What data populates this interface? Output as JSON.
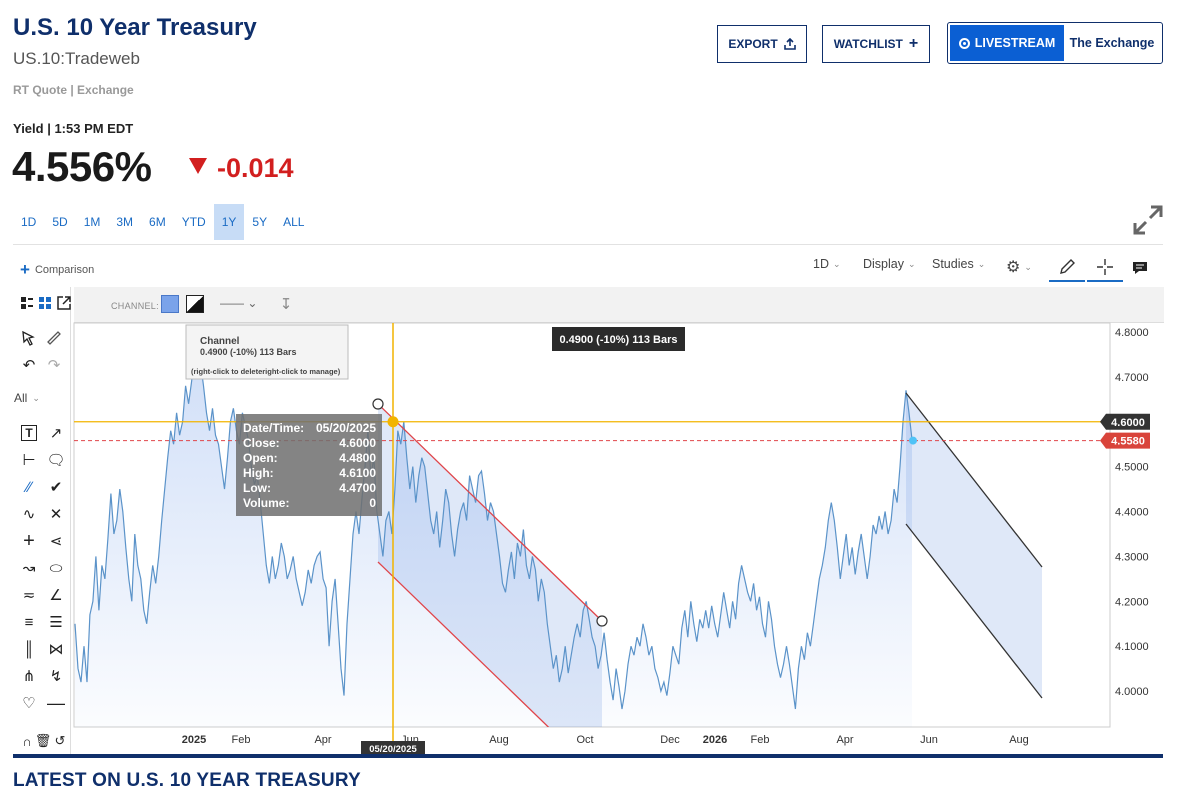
{
  "header": {
    "title": "U.S. 10 Year Treasury",
    "symbol": "US.10:Tradeweb",
    "quote_source": "RT Quote | Exchange",
    "export_label": "EXPORT",
    "watchlist_label": "WATCHLIST",
    "livestream_label": "LIVESTREAM",
    "exchange_label": "The Exchange"
  },
  "quote": {
    "label": "Yield | 1:53 PM EDT",
    "value": "4.556%",
    "change": "-0.014",
    "direction": "down",
    "change_color": "#d21f1f"
  },
  "ranges": [
    {
      "label": "1D",
      "active": false
    },
    {
      "label": "5D",
      "active": false
    },
    {
      "label": "1M",
      "active": false
    },
    {
      "label": "3M",
      "active": false
    },
    {
      "label": "6M",
      "active": false
    },
    {
      "label": "YTD",
      "active": false
    },
    {
      "label": "1Y",
      "active": true
    },
    {
      "label": "5Y",
      "active": false
    },
    {
      "label": "ALL",
      "active": false
    }
  ],
  "toolbar": {
    "comparison_label": "Comparison",
    "interval_label": "1D",
    "display_label": "Display",
    "studies_label": "Studies",
    "channel_label": "CHANNEL:",
    "all_label": "All"
  },
  "chart_data": {
    "type": "line",
    "ylim": [
      3.92,
      4.82
    ],
    "y_ticks": [
      "4.8000",
      "4.7000",
      "4.6000",
      "4.5000",
      "4.4000",
      "4.3000",
      "4.2000",
      "4.1000",
      "4.0000"
    ],
    "x_ticks": [
      {
        "label": "2025",
        "bold": true
      },
      {
        "label": "Feb",
        "bold": false
      },
      {
        "label": "Apr",
        "bold": false
      },
      {
        "label": "Jun",
        "bold": false
      },
      {
        "label": "Aug",
        "bold": false
      },
      {
        "label": "Oct",
        "bold": false
      },
      {
        "label": "Dec",
        "bold": false
      },
      {
        "label": "2026",
        "bold": true
      },
      {
        "label": "Feb",
        "bold": false
      },
      {
        "label": "Apr",
        "bold": false
      },
      {
        "label": "Jun",
        "bold": false
      },
      {
        "label": "Aug",
        "bold": false
      }
    ],
    "series_values": [
      4.15,
      4.05,
      4.02,
      4.1,
      4.02,
      4.17,
      4.2,
      4.3,
      4.18,
      4.28,
      4.25,
      4.34,
      4.44,
      4.35,
      4.38,
      4.45,
      4.4,
      4.32,
      4.25,
      4.2,
      4.35,
      4.28,
      4.25,
      4.18,
      4.15,
      4.22,
      4.28,
      4.24,
      4.3,
      4.38,
      4.45,
      4.52,
      4.58,
      4.55,
      4.62,
      4.57,
      4.6,
      4.68,
      4.64,
      4.69,
      4.75,
      4.7,
      4.73,
      4.68,
      4.62,
      4.58,
      4.63,
      4.57,
      4.55,
      4.5,
      4.45,
      4.52,
      4.6,
      4.63,
      4.58,
      4.55,
      4.62,
      4.59,
      4.56,
      4.5,
      4.46,
      4.48,
      4.42,
      4.35,
      4.28,
      4.24,
      4.3,
      4.25,
      4.28,
      4.33,
      4.3,
      4.25,
      4.27,
      4.3,
      4.25,
      4.22,
      4.19,
      4.22,
      4.27,
      4.24,
      4.28,
      4.3,
      4.31,
      4.25,
      4.23,
      4.1,
      4.2,
      4.25,
      4.15,
      4.05,
      3.99,
      4.15,
      4.25,
      4.35,
      4.4,
      4.35,
      4.43,
      4.5,
      4.58,
      4.48,
      4.52,
      4.4,
      4.35,
      4.3,
      4.38,
      4.4,
      4.35,
      4.45,
      4.58,
      4.55,
      4.6,
      4.52,
      4.45,
      4.5,
      4.42,
      4.48,
      4.52,
      4.5,
      4.44,
      4.38,
      4.35,
      4.4,
      4.32,
      4.38,
      4.45,
      4.42,
      4.35,
      4.3,
      4.36,
      4.4,
      4.42,
      4.38,
      4.48,
      4.45,
      4.42,
      4.48,
      4.49,
      4.44,
      4.38,
      4.42,
      4.4,
      4.35,
      4.3,
      4.24,
      4.22,
      4.27,
      4.31,
      4.25,
      4.33,
      4.3,
      4.36,
      4.28,
      4.25,
      4.3,
      4.27,
      4.2,
      4.25,
      4.22,
      4.15,
      4.1,
      4.05,
      4.08,
      4.02,
      4.05,
      4.1,
      4.04,
      4.08,
      4.12,
      4.15,
      4.12,
      4.18,
      4.2,
      4.16,
      4.12,
      4.1,
      4.05,
      4.08,
      4.13,
      4.07,
      4.02,
      3.98,
      4.05,
      4.01,
      3.96,
      4.0,
      4.06,
      4.1,
      4.08,
      4.12,
      4.1,
      4.15,
      4.12,
      4.08,
      4.1,
      4.05,
      4.03,
      4.0,
      4.02,
      3.99,
      4.04,
      4.1,
      4.08,
      4.06,
      4.14,
      4.18,
      4.12,
      4.2,
      4.15,
      4.11,
      4.16,
      4.14,
      4.18,
      4.14,
      4.19,
      4.15,
      4.12,
      4.17,
      4.22,
      4.18,
      4.14,
      4.2,
      4.16,
      4.24,
      4.28,
      4.25,
      4.22,
      4.2,
      4.24,
      4.18,
      4.21,
      4.15,
      4.12,
      4.2,
      4.16,
      4.1,
      4.06,
      4.03,
      4.06,
      4.1,
      4.06,
      4.01,
      3.96,
      4.05,
      4.1,
      4.07,
      4.13,
      4.1,
      4.15,
      4.2,
      4.25,
      4.28,
      4.32,
      4.38,
      4.42,
      4.38,
      4.32,
      4.25,
      4.3,
      4.35,
      4.28,
      4.32,
      4.26,
      4.31,
      4.35,
      4.3,
      4.25,
      4.3,
      4.37,
      4.35,
      4.39,
      4.36,
      4.4,
      4.35,
      4.38,
      4.45,
      4.42,
      4.5,
      4.6,
      4.67,
      4.62,
      4.56
    ],
    "crosshair_y": 4.6,
    "last_value": 4.558,
    "y_badges": [
      "4.6000",
      "4.5580"
    ],
    "channel_badge": "0.4900 (-10%) 113 Bars",
    "date_badge": "05/20/2025",
    "tooltip": {
      "rows": [
        {
          "k": "Date/Time:",
          "v": "05/20/2025"
        },
        {
          "k": "Close:",
          "v": "4.6000"
        },
        {
          "k": "Open:",
          "v": "4.4800"
        },
        {
          "k": "High:",
          "v": "4.6100"
        },
        {
          "k": "Low:",
          "v": "4.4700"
        },
        {
          "k": "Volume:",
          "v": "0"
        }
      ]
    },
    "channel_popup": {
      "title": "Channel",
      "detail": "0.4900 (-10%) 113 Bars",
      "hint": "(right-click to deleteright-click to manage)"
    }
  },
  "footer": {
    "latest_title": "LATEST ON U.S. 10 YEAR TREASURY"
  }
}
